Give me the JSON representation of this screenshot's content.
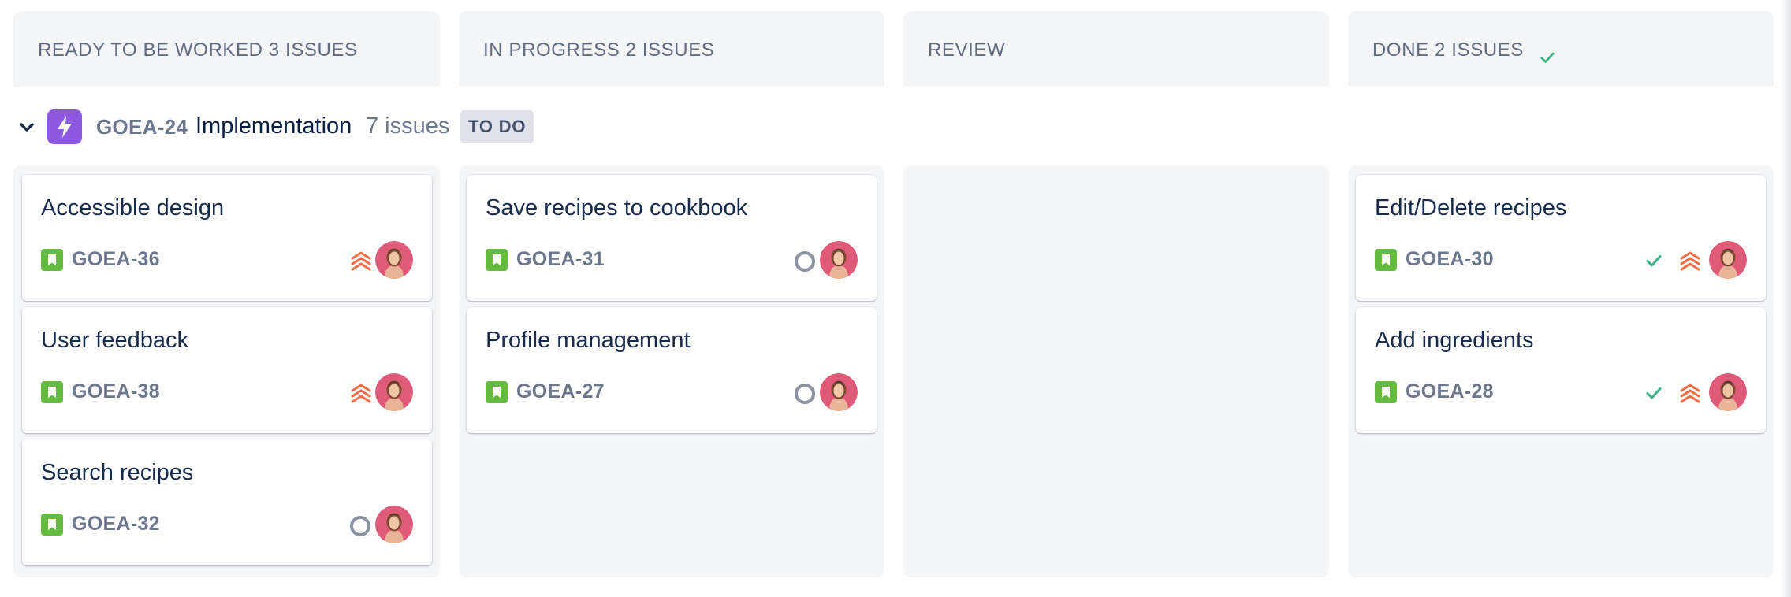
{
  "columns": [
    {
      "title": "READY TO BE WORKED 3 ISSUES",
      "has_check": false
    },
    {
      "title": "IN PROGRESS 2 ISSUES",
      "has_check": false
    },
    {
      "title": "REVIEW",
      "has_check": false
    },
    {
      "title": "DONE 2 ISSUES",
      "has_check": true
    }
  ],
  "swimlane": {
    "key": "GOEA-24",
    "name": "Implementation",
    "count": "7 issues",
    "status": "TO DO",
    "icon": "lightning-icon",
    "expanded": true
  },
  "cards": {
    "ready": [
      {
        "summary": "Accessible design",
        "key": "GOEA-36",
        "priority": "highest",
        "status_icon": "none"
      },
      {
        "summary": "User feedback",
        "key": "GOEA-38",
        "priority": "highest",
        "status_icon": "none"
      },
      {
        "summary": "Search recipes",
        "key": "GOEA-32",
        "priority": "none",
        "status_icon": "open-circle"
      }
    ],
    "in_progress": [
      {
        "summary": "Save recipes to cookbook",
        "key": "GOEA-31",
        "priority": "none",
        "status_icon": "open-circle"
      },
      {
        "summary": "Profile management",
        "key": "GOEA-27",
        "priority": "none",
        "status_icon": "open-circle"
      }
    ],
    "review": [],
    "done": [
      {
        "summary": "Edit/Delete recipes",
        "key": "GOEA-30",
        "priority": "highest",
        "status_icon": "done-check"
      },
      {
        "summary": "Add ingredients",
        "key": "GOEA-28",
        "priority": "highest",
        "status_icon": "done-check"
      }
    ]
  },
  "colors": {
    "column_bg": "#f4f5f7",
    "epic_purple": "#8d59e3",
    "story_green": "#63ba3c",
    "priority_orange": "#f06b46",
    "done_green": "#36b37e",
    "avatar_bg": "#e05b79"
  }
}
